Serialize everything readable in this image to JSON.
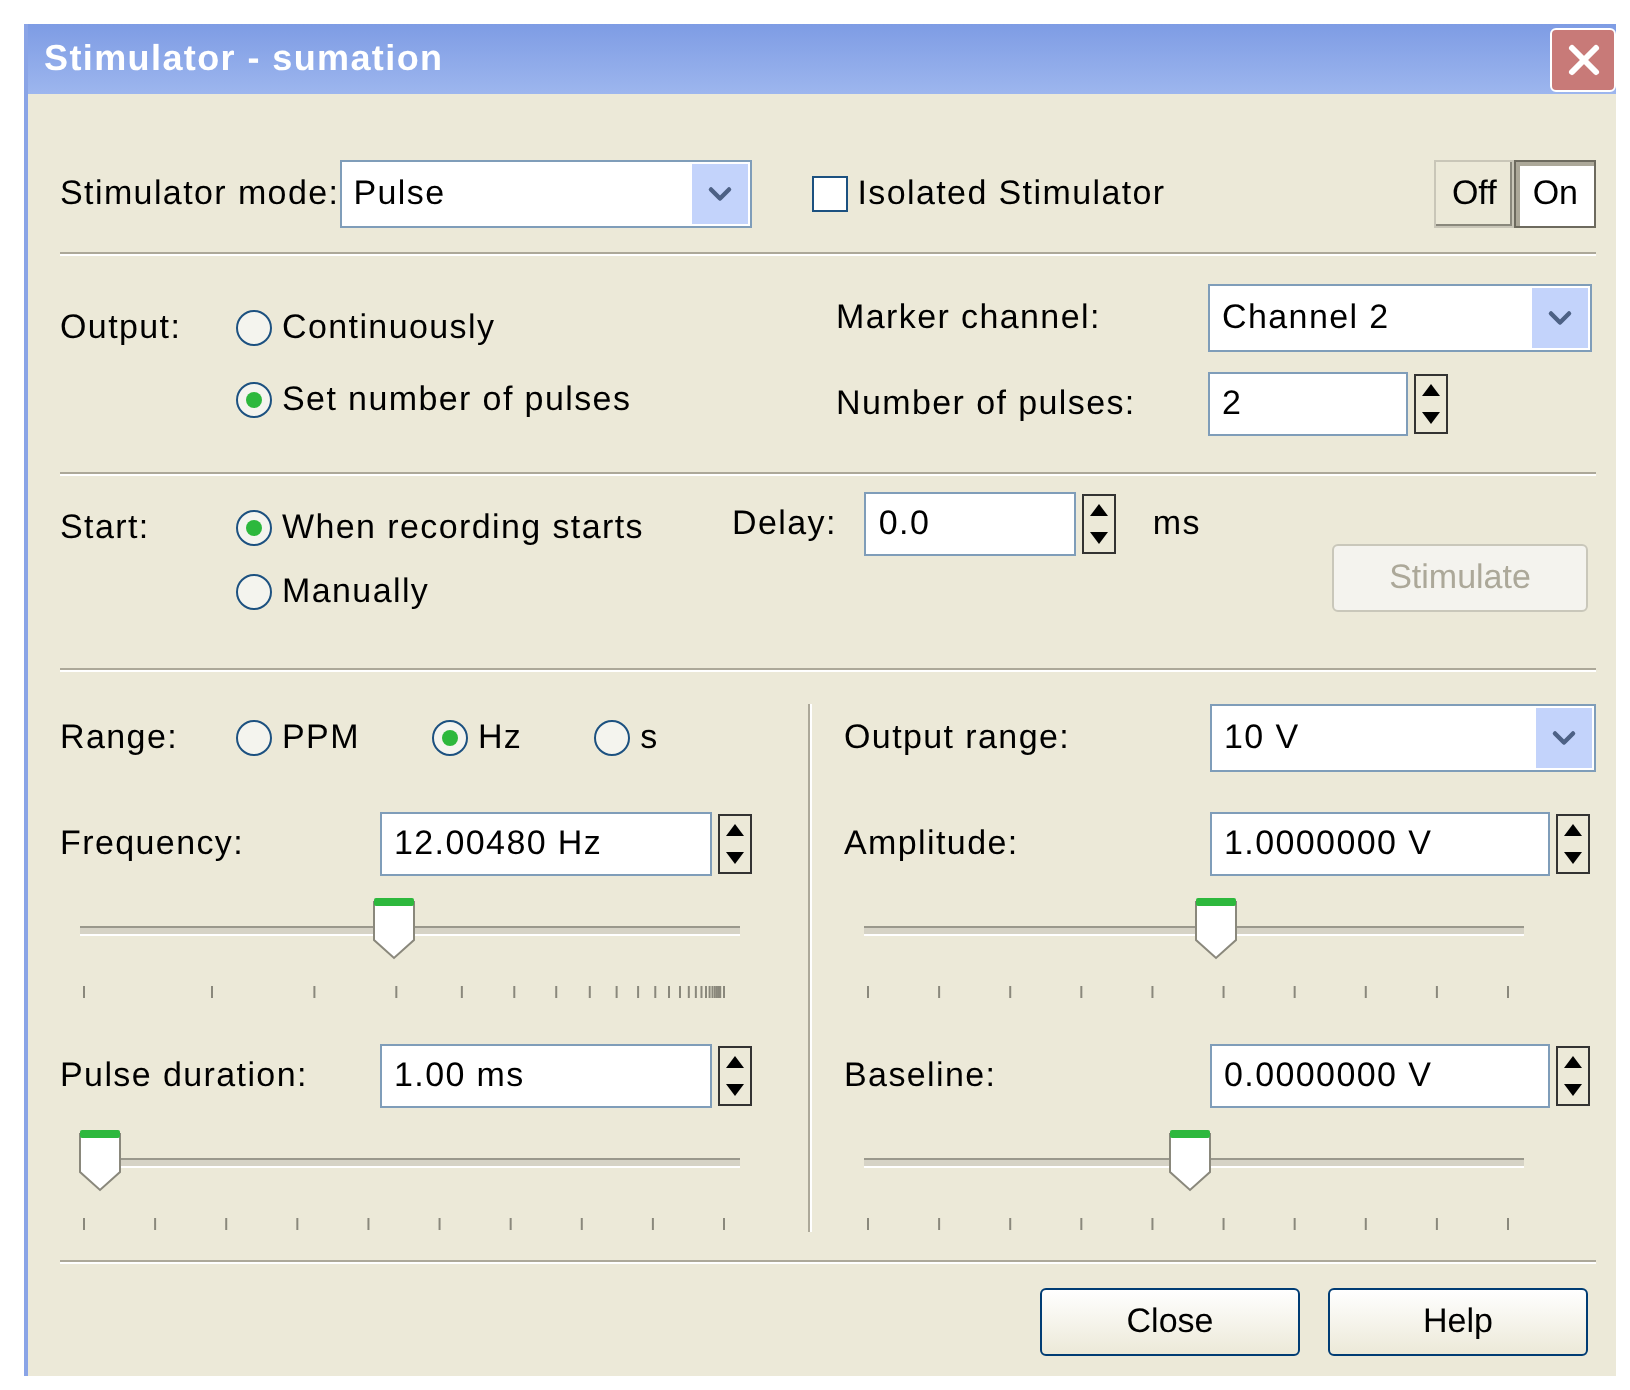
{
  "window": {
    "title": "Stimulator - sumation"
  },
  "mode": {
    "label": "Stimulator mode:",
    "value": "Pulse"
  },
  "isolated": {
    "label": "Isolated Stimulator",
    "checked": false
  },
  "power": [
    {
      "label": "Off",
      "selected": false
    },
    {
      "label": "On",
      "selected": true
    }
  ],
  "output": {
    "label": "Output:",
    "options": [
      {
        "label": "Continuously",
        "selected": false
      },
      {
        "label": "Set number of pulses",
        "selected": true
      }
    ]
  },
  "marker_channel": {
    "label": "Marker channel:",
    "value": "Channel 2"
  },
  "number_of_pulses": {
    "label": "Number of pulses:",
    "value": "2"
  },
  "start": {
    "label": "Start:",
    "options": [
      {
        "label": "When recording starts",
        "selected": true
      },
      {
        "label": "Manually",
        "selected": false
      }
    ]
  },
  "delay": {
    "label": "Delay:",
    "value": "0.0",
    "unit": "ms"
  },
  "stimulate_button": {
    "label": "Stimulate",
    "disabled": true
  },
  "range": {
    "label": "Range:",
    "options": [
      {
        "label": "PPM",
        "selected": false
      },
      {
        "label": "Hz",
        "selected": true
      },
      {
        "label": "s",
        "selected": false
      }
    ]
  },
  "frequency": {
    "label": "Frequency:",
    "value": "12.00480 Hz",
    "level": 0.49
  },
  "pulse_duration": {
    "label": "Pulse duration:",
    "value": "1.00 ms",
    "level": 0.03
  },
  "output_range": {
    "label": "Output range:",
    "value": "10 V"
  },
  "amplitude": {
    "label": "Amplitude:",
    "value": "1.0000000 V",
    "level": 0.55
  },
  "baseline": {
    "label": "Baseline:",
    "value": "0.0000000 V",
    "level": 0.51
  },
  "buttons": [
    {
      "label": "Close"
    },
    {
      "label": "Help"
    }
  ]
}
